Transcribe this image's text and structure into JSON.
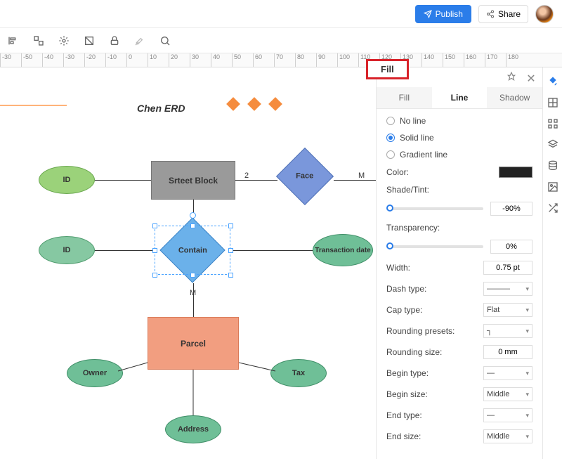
{
  "topbar": {
    "publish": "Publish",
    "share": "Share"
  },
  "ruler": [
    "-30",
    "-50",
    "-40",
    "-30",
    "-20",
    "-10",
    "0",
    "10",
    "20",
    "30",
    "40",
    "50",
    "60",
    "70",
    "80",
    "90",
    "100",
    "110",
    "120",
    "130",
    "140",
    "150",
    "160",
    "170",
    "180"
  ],
  "canvas": {
    "title": "Chen ERD",
    "nodes": {
      "id1": "ID",
      "street_block": "Srteet Block",
      "face": "Face",
      "id2": "ID",
      "contain": "Contain",
      "transaction_date": "Transaction date",
      "parcel": "Parcel",
      "owner": "Owner",
      "tax": "Tax",
      "address": "Address"
    },
    "cardinality": {
      "sb_face_left": "2",
      "sb_face_right": "M",
      "contain_down": "M"
    }
  },
  "panel": {
    "fill_tab_title": "Fill",
    "tabs": {
      "fill": "Fill",
      "line": "Line",
      "shadow": "Shadow"
    },
    "line_type": {
      "none": "No line",
      "solid": "Solid line",
      "gradient": "Gradient line"
    },
    "labels": {
      "color": "Color:",
      "shade": "Shade/Tint:",
      "transparency": "Transparency:",
      "width": "Width:",
      "dash": "Dash type:",
      "cap": "Cap type:",
      "round_preset": "Rounding presets:",
      "round_size": "Rounding size:",
      "begin_type": "Begin type:",
      "begin_size": "Begin size:",
      "end_type": "End type:",
      "end_size": "End size:"
    },
    "values": {
      "shade": "-90%",
      "transparency": "0%",
      "width": "0.75 pt",
      "dash": "———",
      "cap": "Flat",
      "round_preset": "┐",
      "round_size": "0 mm",
      "begin_type": "—",
      "begin_size": "Middle",
      "end_type": "—",
      "end_size": "Middle",
      "color": "#222222"
    }
  }
}
